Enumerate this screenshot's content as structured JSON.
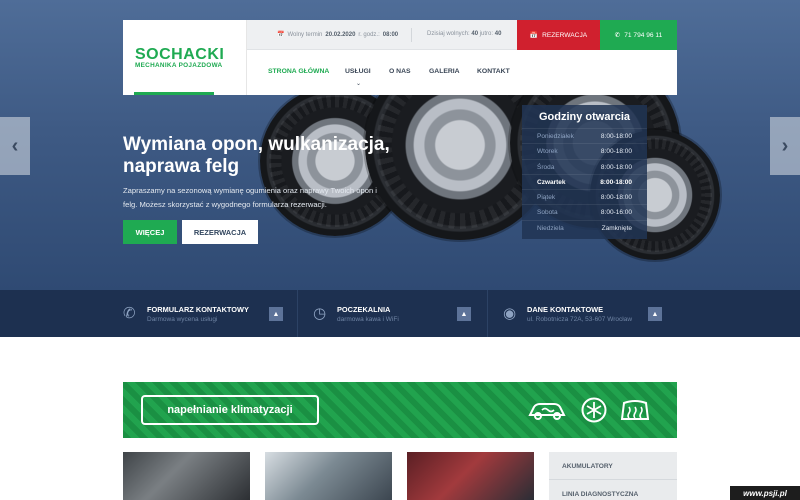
{
  "brand": {
    "name": "SOCHACKI",
    "tagline": "MECHANIKA POJAZDOWA",
    "green": "#1faa52",
    "red": "#d0202e",
    "navy": "#1d3050"
  },
  "topbar": {
    "date_label": "Wolny termin",
    "date_value": "20.02.2020",
    "time_label": "r. godz.:",
    "time_value": "08:00",
    "free_label": "Dzisiaj wolnych:",
    "free_today": "40",
    "free_tomorrow_label": "jutro:",
    "free_tomorrow": "40",
    "reservation_label": "REZERWACJA",
    "phone": "71 794 96 11"
  },
  "nav": {
    "items": [
      {
        "label": "STRONA GŁÓWNA",
        "active": true
      },
      {
        "label": "USŁUGI"
      },
      {
        "label": "O NAS"
      },
      {
        "label": "GALERIA"
      },
      {
        "label": "KONTAKT"
      }
    ]
  },
  "hero": {
    "title": "Wymiana opon, wulkanizacja, naprawa felg",
    "text": "Zapraszamy na sezonową wymianę ogumienia oraz naprawy Twoich opon i felg.  Możesz skorzystać z wygodnego formularza rezerwacji.",
    "btn_more": "WIĘCEJ",
    "btn_reserve": "REZERWACJA"
  },
  "hours": {
    "title": "Godziny otwarcia",
    "rows": [
      {
        "day": "Poniedziałek",
        "time": "8:00-18:00"
      },
      {
        "day": "Wtorek",
        "time": "8:00-18:00"
      },
      {
        "day": "Środa",
        "time": "8:00-18:00"
      },
      {
        "day": "Czwartek",
        "time": "8:00-18:00",
        "today": true
      },
      {
        "day": "Piątek",
        "time": "8:00-18:00"
      },
      {
        "day": "Sobota",
        "time": "8:00-16:00"
      },
      {
        "day": "Niedziela",
        "time": "Zamknięte"
      }
    ]
  },
  "infobar": [
    {
      "icon": "phone-icon",
      "title": "FORMULARZ KONTAKTOWY",
      "sub": "Darmowa wycena usługi"
    },
    {
      "icon": "clock-icon",
      "title": "POCZEKALNIA",
      "sub": "darmowa kawa i WiFi"
    },
    {
      "icon": "map-pin-icon",
      "title": "DANE KONTAKTOWE",
      "sub": "ul. Robotnicza 72A, 53-607 Wrocław"
    }
  ],
  "banner": {
    "label": "napełnianie klimatyzacji",
    "icons": [
      "car-air-icon",
      "snowflake-icon",
      "defrost-icon"
    ]
  },
  "sidebar": {
    "items": [
      "AKUMULATORY",
      "LINIA DIAGNOSTYCZNA"
    ]
  },
  "watermark": "www.psji.pl"
}
